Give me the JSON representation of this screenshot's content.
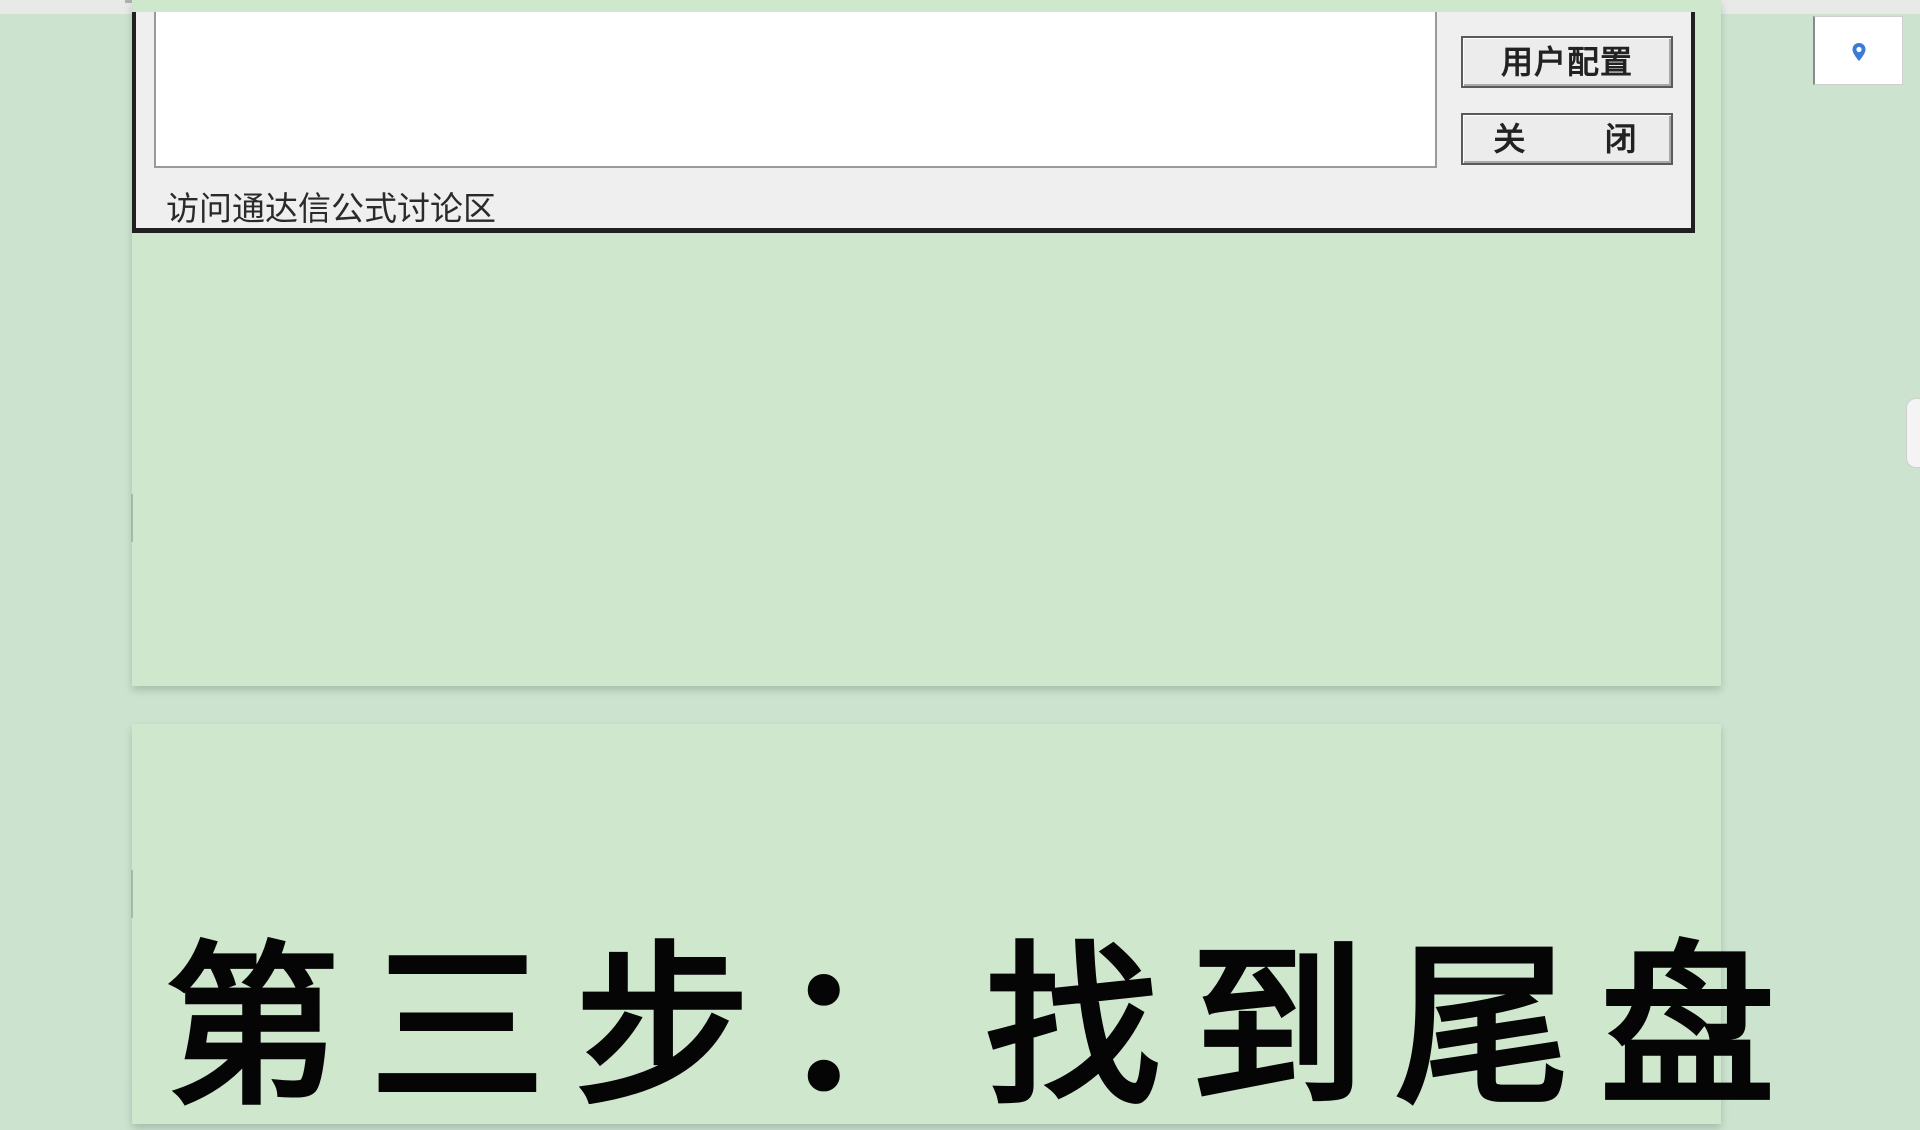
{
  "dialog": {
    "user_config_button": "用户配置",
    "close_button": "关 闭",
    "forum_link": "访问通达信公式讨论区"
  },
  "document": {
    "heading": "第三步：找到尾盘"
  },
  "icons": {
    "location": "location-pin-icon"
  },
  "colors": {
    "page_background": "#cfe7cc",
    "viewport_background": "#cce4cf",
    "location_icon": "#3a7bd5"
  }
}
